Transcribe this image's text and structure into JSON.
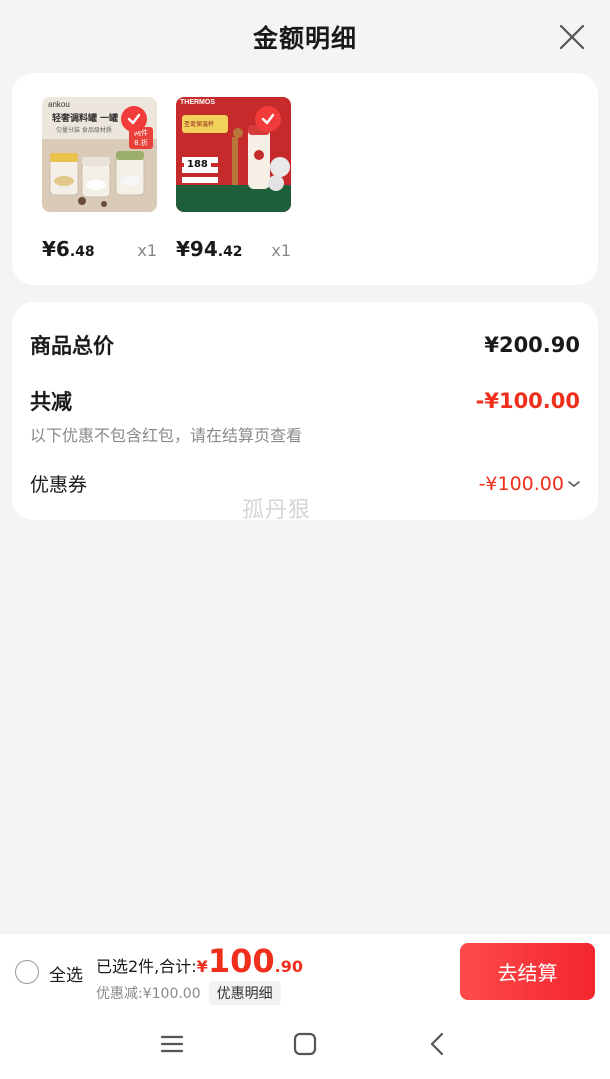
{
  "header": {
    "title": "金额明细"
  },
  "products": [
    {
      "brand": "ankou",
      "image_caption": "轻奢调料罐",
      "image_sub": "一罐",
      "image_note": "匀量分装 食品级材质",
      "badge_line1": "两件",
      "badge_line2": "8.折",
      "price_int": "¥6",
      "price_dec": ".48",
      "qty": "x1"
    },
    {
      "brand": "THERMOS",
      "image_tag": "圣诞保温杯",
      "image_price": "188",
      "price_int": "¥94",
      "price_dec": ".42",
      "qty": "x1"
    }
  ],
  "summary": {
    "total_label": "商品总价",
    "total_value": "¥200.90",
    "reduce_label": "共减",
    "reduce_value": "-¥100.00",
    "note": "以下优惠不包含红包，请在结算页查看",
    "coupon_label": "优惠券",
    "coupon_value": "-¥100.00"
  },
  "watermark": "孤丹狠",
  "bottom": {
    "select_all": "全选",
    "selected_text": "已选2件,合计:",
    "total_yen": "¥",
    "total_int": "100",
    "total_dec": ".90",
    "discount_text": "优惠减:¥100.00",
    "detail_label": "优惠明细",
    "checkout_label": "去结算"
  },
  "colors": {
    "accent": "#f02e1c",
    "button": "#f4262e"
  }
}
